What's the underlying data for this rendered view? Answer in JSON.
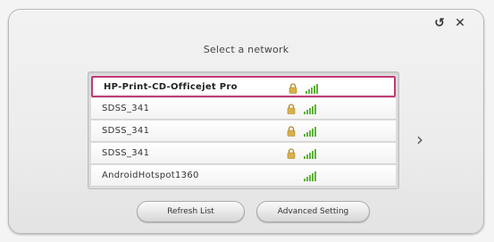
{
  "dialog": {
    "title": "Select a network",
    "back_icon": "back-return-icon",
    "close_icon": "close-icon"
  },
  "networks": [
    {
      "name": "HP-Print-CD-Officejet Pro",
      "secured": true,
      "signal": "strong",
      "selected": true
    },
    {
      "name": "SDSS_341",
      "secured": true,
      "signal": "strong",
      "selected": false
    },
    {
      "name": "SDSS_341",
      "secured": true,
      "signal": "strong",
      "selected": false
    },
    {
      "name": "SDSS_341",
      "secured": true,
      "signal": "strong",
      "selected": false
    },
    {
      "name": "AndroidHotspot1360",
      "secured": false,
      "signal": "strong",
      "selected": false
    }
  ],
  "next_icon": "chevron-right-icon",
  "buttons": {
    "refresh_label": "Refresh List",
    "advanced_label": "Advanced Setting"
  },
  "colors": {
    "selection_border": "#c23a78",
    "signal_green": "#5fb23a",
    "lock_gold": "#c9a23a"
  }
}
